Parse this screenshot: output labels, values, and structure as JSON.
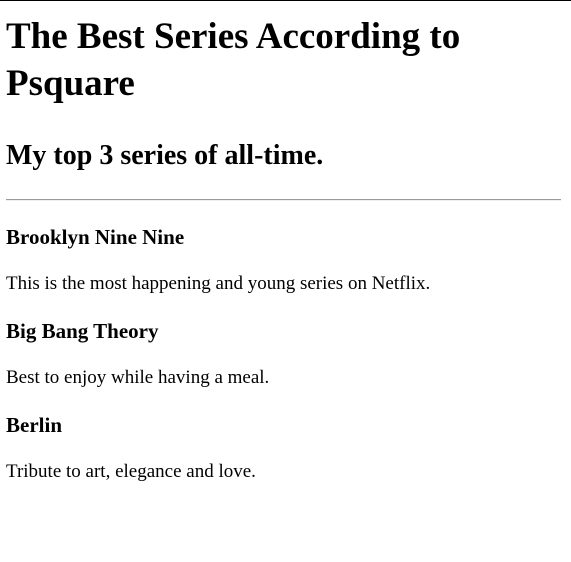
{
  "page": {
    "title": "The Best Series According to Psquare",
    "subtitle": "My top 3 series of all-time."
  },
  "series": [
    {
      "name": "Brooklyn Nine Nine",
      "description": "This is the most happening and young series on Netflix."
    },
    {
      "name": "Big Bang Theory",
      "description": "Best to enjoy while having a meal."
    },
    {
      "name": "Berlin",
      "description": "Tribute to art, elegance and love."
    }
  ]
}
